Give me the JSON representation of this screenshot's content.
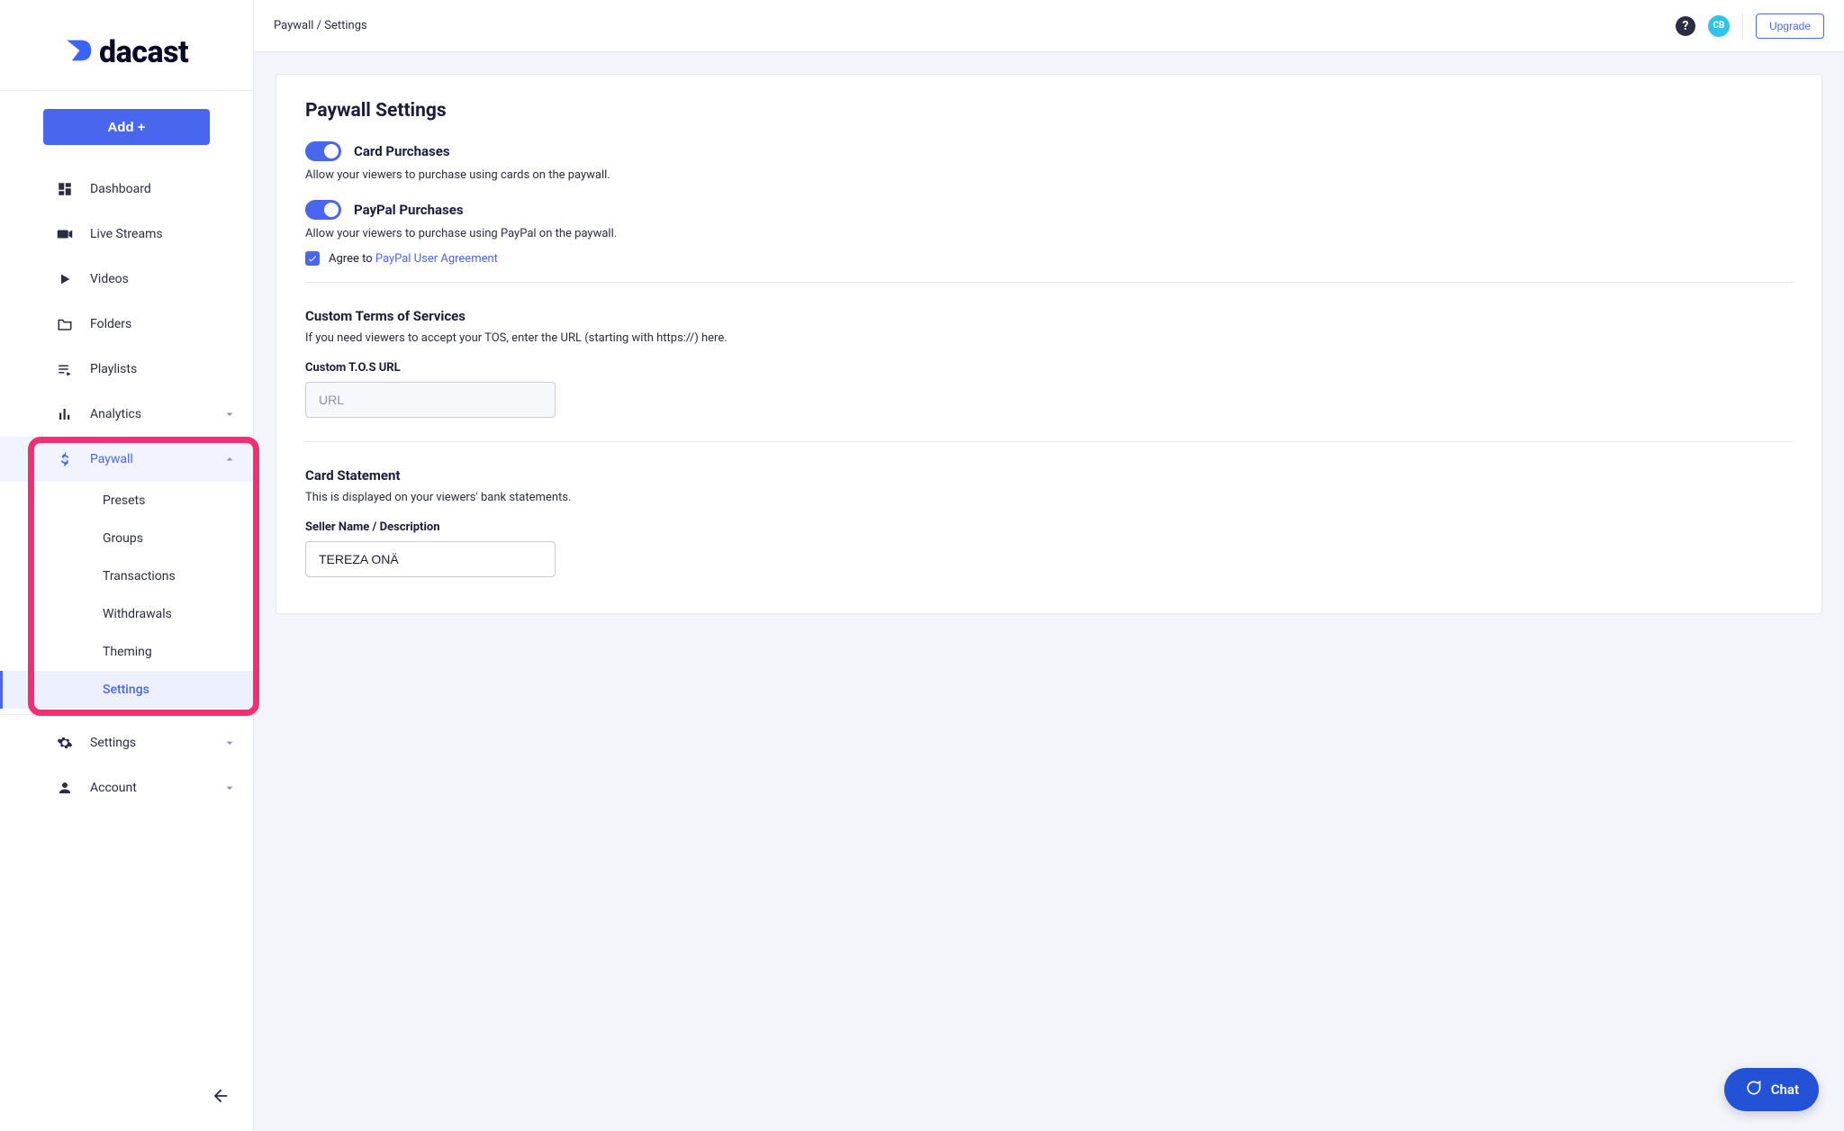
{
  "brand": {
    "name": "dacast"
  },
  "header": {
    "breadcrumb": "Paywall  /  Settings",
    "upgrade_label": "Upgrade",
    "avatar_initials": "CB"
  },
  "sidebar": {
    "add_button_label": "Add +",
    "items": [
      {
        "label": "Dashboard",
        "icon": "dashboard"
      },
      {
        "label": "Live Streams",
        "icon": "video-cam"
      },
      {
        "label": "Videos",
        "icon": "play"
      },
      {
        "label": "Folders",
        "icon": "folder"
      },
      {
        "label": "Playlists",
        "icon": "playlist"
      },
      {
        "label": "Analytics",
        "icon": "bar-chart",
        "expandable": true
      },
      {
        "label": "Paywall",
        "icon": "dollar",
        "expandable": true,
        "active": true
      },
      {
        "label": "Settings",
        "icon": "gear",
        "expandable": true
      },
      {
        "label": "Account",
        "icon": "person",
        "expandable": true
      }
    ],
    "paywall_subitems": [
      {
        "label": "Presets"
      },
      {
        "label": "Groups"
      },
      {
        "label": "Transactions"
      },
      {
        "label": "Withdrawals"
      },
      {
        "label": "Theming"
      },
      {
        "label": "Settings",
        "active": true
      }
    ]
  },
  "page": {
    "title": "Paywall Settings",
    "card_purchases": {
      "label": "Card Purchases",
      "desc": "Allow your viewers to purchase using cards on the paywall.",
      "on": true
    },
    "paypal_purchases": {
      "label": "PayPal Purchases",
      "desc": "Allow your viewers to purchase using PayPal on the paywall.",
      "on": true,
      "agree_prefix": "Agree to ",
      "agree_link": "PayPal User Agreement",
      "agree_checked": true
    },
    "tos": {
      "title": "Custom Terms of Services",
      "desc": "If you need viewers to accept your TOS, enter the URL (starting with https://) here.",
      "field_label": "Custom T.O.S URL",
      "placeholder": "URL",
      "value": ""
    },
    "statement": {
      "title": "Card Statement",
      "desc": "This is displayed on your viewers' bank statements.",
      "field_label": "Seller Name / Description",
      "value": "TEREZA ONÄ"
    }
  },
  "chat": {
    "label": "Chat"
  }
}
